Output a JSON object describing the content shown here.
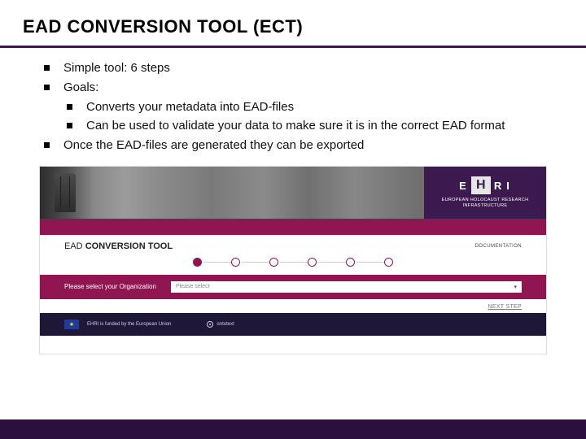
{
  "title": "EAD CONVERSION TOOL (ECT)",
  "bullets": {
    "b1": "Simple tool: 6 steps",
    "b2": "Goals:",
    "b2a": "Converts your metadata into EAD-files",
    "b2b": "Can be used to validate your data to make sure it is in the correct EAD format",
    "b3": "Once the EAD-files are generated they can be exported"
  },
  "shot": {
    "ehri_e": "E",
    "ehri_h": "H",
    "ehri_r": "R",
    "ehri_i": "I",
    "ehri_sub": "EUROPEAN HOLOCAUST RESEARCH INFRASTRUCTURE",
    "tool_prefix": "EAD ",
    "tool_bold": "CONVERSION TOOL",
    "doc": "DOCUMENTATION",
    "org_label": "Please select your Organization",
    "org_placeholder": "Please select",
    "next": "NEXT STEP",
    "funded": "EHRI is funded by the European Union",
    "onto": "ontotext"
  }
}
